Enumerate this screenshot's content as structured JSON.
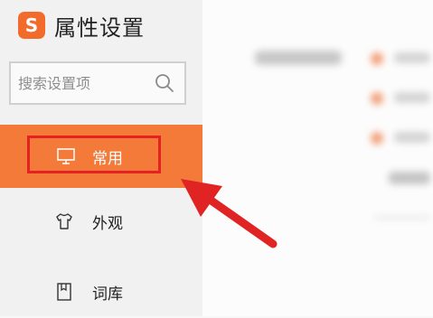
{
  "brand": {
    "logo_letter": "S",
    "title": "属性设置"
  },
  "search": {
    "placeholder": "搜索设置项"
  },
  "nav": {
    "common": {
      "label": "常用",
      "icon": "monitor-icon",
      "active": true
    },
    "appearance": {
      "label": "外观",
      "icon": "shirt-icon"
    },
    "lexicon": {
      "label": "词库",
      "icon": "book-icon"
    }
  },
  "colors": {
    "accent": "#f47a3a",
    "highlight_box": "#e52222",
    "arrow": "#e02424",
    "logo": "#f26b2b"
  }
}
